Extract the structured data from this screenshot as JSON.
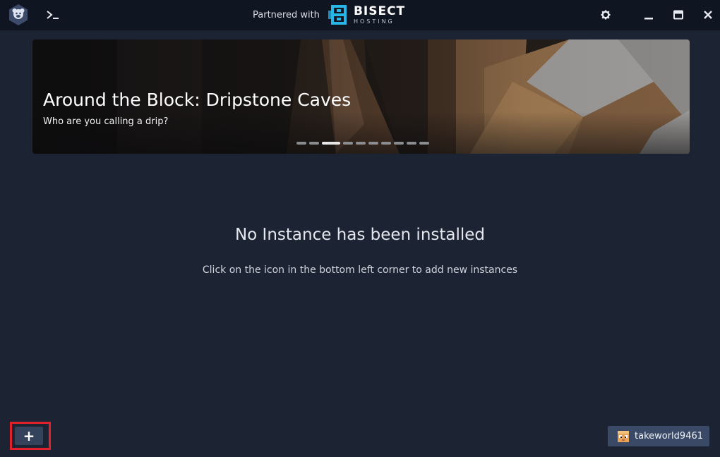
{
  "titlebar": {
    "partner_text": "Partnered with",
    "partner_brand": "BISECT",
    "partner_brand_sub": "HOSTING",
    "icons": {
      "logo": "gdlauncher-logo-icon",
      "terminal": "terminal-icon",
      "settings": "gear-icon",
      "minimize": "minimize-icon",
      "maximize": "maximize-icon",
      "close": "close-icon"
    }
  },
  "banner": {
    "title": "Around the Block: Dripstone Caves",
    "subtitle": "Who are you calling a drip?",
    "slide_count": 10,
    "active_slide": 3
  },
  "empty_state": {
    "title": "No Instance has been installed",
    "hint": "Click on the icon in the bottom left corner to add new instances"
  },
  "bottom": {
    "add_label": "+",
    "account_name": "takeworld9461"
  },
  "colors": {
    "background": "#1c2433",
    "titlebar": "#0f1521",
    "button": "#34425b",
    "account": "#3a4a66",
    "highlight": "#e0202a",
    "bisect_accent": "#27b6e6"
  }
}
